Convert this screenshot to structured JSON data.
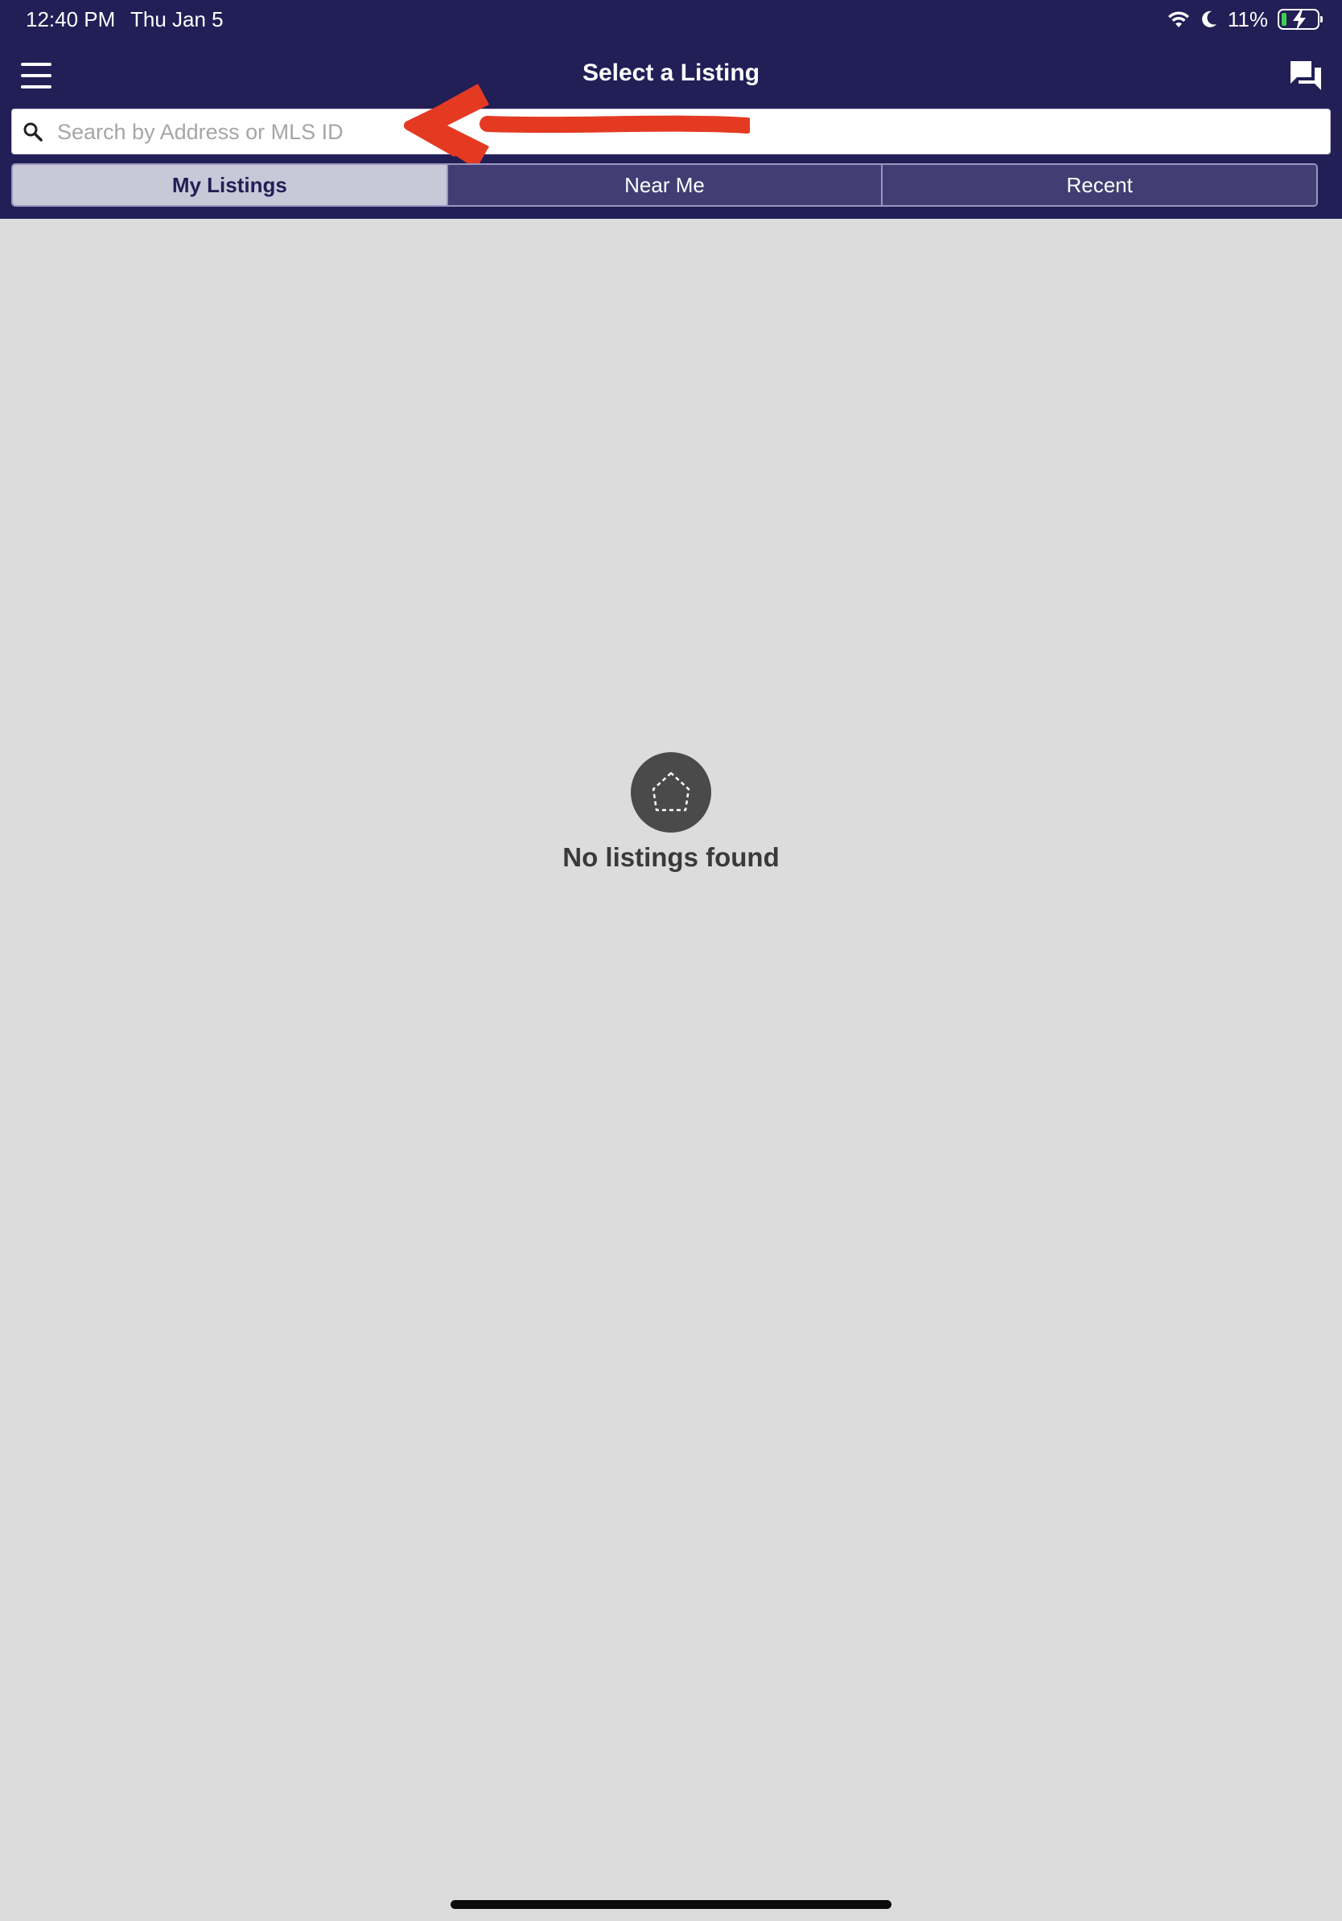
{
  "status_bar": {
    "time": "12:40 PM",
    "date": "Thu Jan 5",
    "battery_percent": "11%",
    "icons": [
      "wifi-icon",
      "do-not-disturb-moon-icon",
      "battery-charging-icon"
    ]
  },
  "header": {
    "title": "Select a Listing",
    "menu_icon": "hamburger-menu-icon",
    "chat_icon": "chat-bubbles-icon"
  },
  "search": {
    "placeholder": "Search by Address or MLS ID",
    "value": ""
  },
  "tabs": [
    {
      "label": "My Listings",
      "active": true
    },
    {
      "label": "Near Me",
      "active": false
    },
    {
      "label": "Recent",
      "active": false
    }
  ],
  "empty_state": {
    "message": "No listings found",
    "icon": "empty-house-icon"
  },
  "annotation": {
    "icon": "red-arrow-annotation",
    "color": "#e43a22"
  },
  "colors": {
    "header_bg": "#221e56",
    "tab_active_bg": "#c9c8d8",
    "tab_inactive_bg": "#423d72",
    "content_bg": "#dcdcdc"
  }
}
